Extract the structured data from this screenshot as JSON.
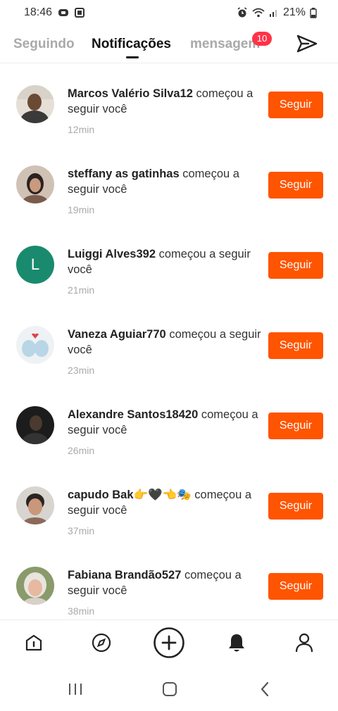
{
  "status_bar": {
    "time": "18:46",
    "battery": "21%",
    "icons": [
      "message-icon",
      "media-icon",
      "alarm-icon",
      "wifi-icon",
      "signal-icon",
      "battery-icon"
    ]
  },
  "header": {
    "tabs": [
      {
        "label": "Seguindo",
        "active": false
      },
      {
        "label": "Notificações",
        "active": true
      },
      {
        "label": "mensagem",
        "active": false
      }
    ],
    "messages_badge": "10",
    "send_icon": "send-icon"
  },
  "notifications": [
    {
      "user": "Marcos Valério Silva12",
      "action": "começou a seguir você",
      "time": "12min",
      "button": "Seguir",
      "avatar": "photo"
    },
    {
      "user": "steffany as gatinhas",
      "action": "começou a seguir você",
      "time": "19min",
      "button": "Seguir",
      "avatar": "photo"
    },
    {
      "user": "Luiggi Alves392",
      "action": "começou a seguir você",
      "time": "21min",
      "button": "Seguir",
      "avatar": "L"
    },
    {
      "user": "Vaneza Aguiar770",
      "action": "começou a seguir você",
      "time": "23min",
      "button": "Seguir",
      "avatar": "photo"
    },
    {
      "user": "Alexandre Santos18420",
      "action": "começou a seguir você",
      "time": "26min",
      "button": "Seguir",
      "avatar": "photo"
    },
    {
      "user": "capudo Bak👉🖤👈🎭",
      "action": "começou a seguir você",
      "time": "37min",
      "button": "Seguir",
      "avatar": "photo"
    },
    {
      "user": "Fabiana Brandão527",
      "action": "começou a seguir você",
      "time": "38min",
      "button": "Seguir",
      "avatar": "photo"
    }
  ],
  "colors": {
    "accent": "#ff5400",
    "badge": "#ff3347",
    "letter_avatar": "#1a8a6e"
  },
  "bottom_nav": [
    "home-icon",
    "explore-icon",
    "create-icon",
    "notifications-icon",
    "profile-icon"
  ],
  "system_nav": [
    "recent-apps-icon",
    "home-button-icon",
    "back-icon"
  ]
}
